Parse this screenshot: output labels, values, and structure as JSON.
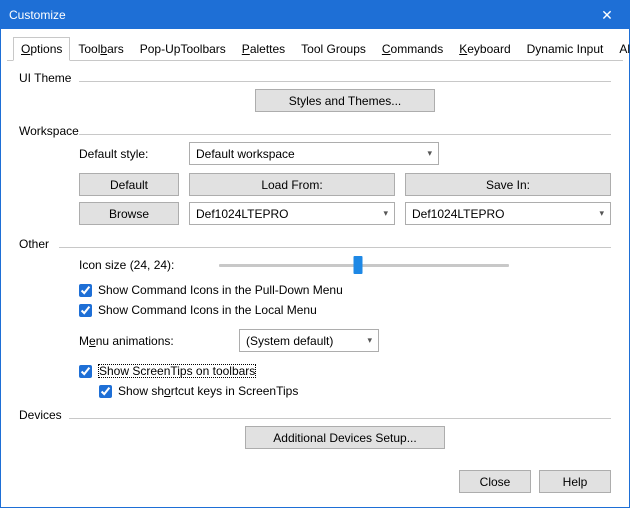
{
  "window": {
    "title": "Customize"
  },
  "tabs": {
    "items": [
      {
        "label": "Options",
        "accel": "O"
      },
      {
        "label": "Toolbars",
        "accel": "b"
      },
      {
        "label": "Pop-UpToolbars",
        "accel": ""
      },
      {
        "label": "Palettes",
        "accel": "P"
      },
      {
        "label": "Tool Groups",
        "accel": ""
      },
      {
        "label": "Commands",
        "accel": "C"
      },
      {
        "label": "Keyboard",
        "accel": "K"
      },
      {
        "label": "Dynamic Input",
        "accel": ""
      },
      {
        "label": "Ali",
        "accel": ""
      }
    ],
    "activeIndex": 0
  },
  "sections": {
    "uiTheme": {
      "label": "UI Theme",
      "stylesBtn": "Styles and Themes..."
    },
    "workspace": {
      "label": "Workspace",
      "defaultStyleLabel": "Default style:",
      "defaultStyleValue": "Default workspace",
      "defaultBtn": "Default",
      "loadFromBtn": "Load From:",
      "saveInBtn": "Save In:",
      "browseBtn": "Browse",
      "loadFromValue": "Def1024LTEPRO",
      "saveInValue": "Def1024LTEPRO"
    },
    "other": {
      "label": "Other",
      "iconSizeLabel": "Icon size (24, 24):",
      "showPullDown": "Show Command Icons in the Pull-Down Menu",
      "showLocal": "Show Command Icons in the Local Menu",
      "menuAnimLabelPre": "M",
      "menuAnimLabelU": "e",
      "menuAnimLabelPost": "nu animations:",
      "menuAnimValue": "(System default)",
      "showScreenTips": "Show ScreenTips on toolbars",
      "showShortcutPre": "Show sh",
      "showShortcutU": "o",
      "showShortcutPost": "rtcut keys in ScreenTips"
    },
    "devices": {
      "label": "Devices",
      "setupBtn": "Additional Devices Setup..."
    }
  },
  "footer": {
    "close": "Close",
    "help": "Help"
  }
}
